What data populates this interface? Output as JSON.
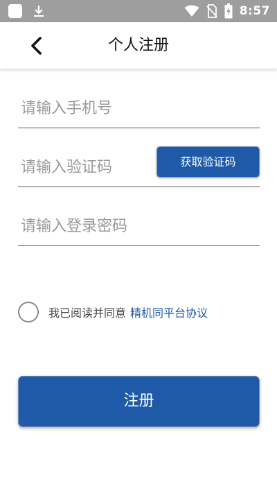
{
  "status_bar": {
    "time": "8:57",
    "icons": [
      "notification-square-icon",
      "download-icon",
      "wifi-icon",
      "no-sim-icon",
      "battery-charging-icon"
    ]
  },
  "header": {
    "title": "个人注册",
    "back_icon": "chevron-left-icon"
  },
  "form": {
    "phone_placeholder": "请输入手机号",
    "phone_value": "",
    "code_placeholder": "请输入验证码",
    "code_value": "",
    "get_code_label": "获取验证码",
    "password_placeholder": "请输入登录密码",
    "password_value": ""
  },
  "agreement": {
    "text": "我已阅读并同意",
    "link": "精机同平台协议",
    "checked": false
  },
  "submit_label": "注册",
  "colors": {
    "primary": "#1e5aa8",
    "status_bar": "#9e9e9e",
    "placeholder": "#9a9a9a",
    "background": "#ffffff"
  }
}
